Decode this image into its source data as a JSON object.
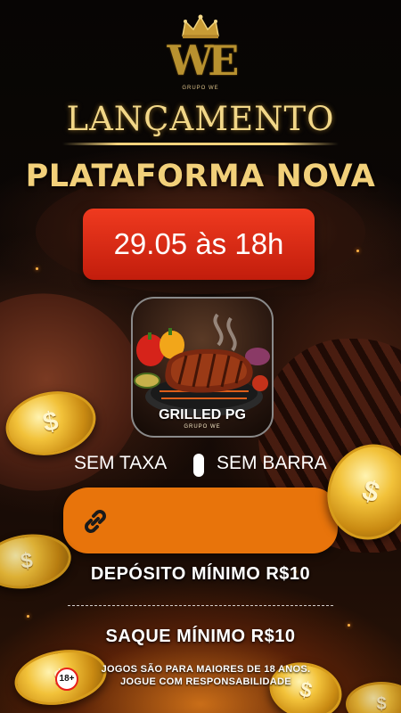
{
  "logo": {
    "mark": "WE",
    "subtitle": "GRUPO WE"
  },
  "headline": {
    "launch": "LANÇAMENTO",
    "platform": "PLATAFORMA NOVA"
  },
  "date_badge": "29.05 às 18h",
  "app": {
    "name": "GRILLED PG",
    "subtitle": "GRUPO WE"
  },
  "features": {
    "left": "SEM TAXA",
    "right": "SEM BARRA"
  },
  "link_button": {
    "icon": "link-icon",
    "label": ""
  },
  "info": {
    "min_deposit": "DEPÓSITO MÍNIMO R$10",
    "min_withdraw": "SAQUE MÍNIMO R$10"
  },
  "footer": {
    "age_badge": "18+",
    "line1": "JOGOS SÃO PARA MAIORES DE 18 ANOS.",
    "line2": "JOGUE COM RESPONSABILIDADE"
  },
  "coin_symbol": "$",
  "colors": {
    "gold": "#f2d07a",
    "date_red": "#e2301a",
    "link_orange": "#e8740b"
  }
}
